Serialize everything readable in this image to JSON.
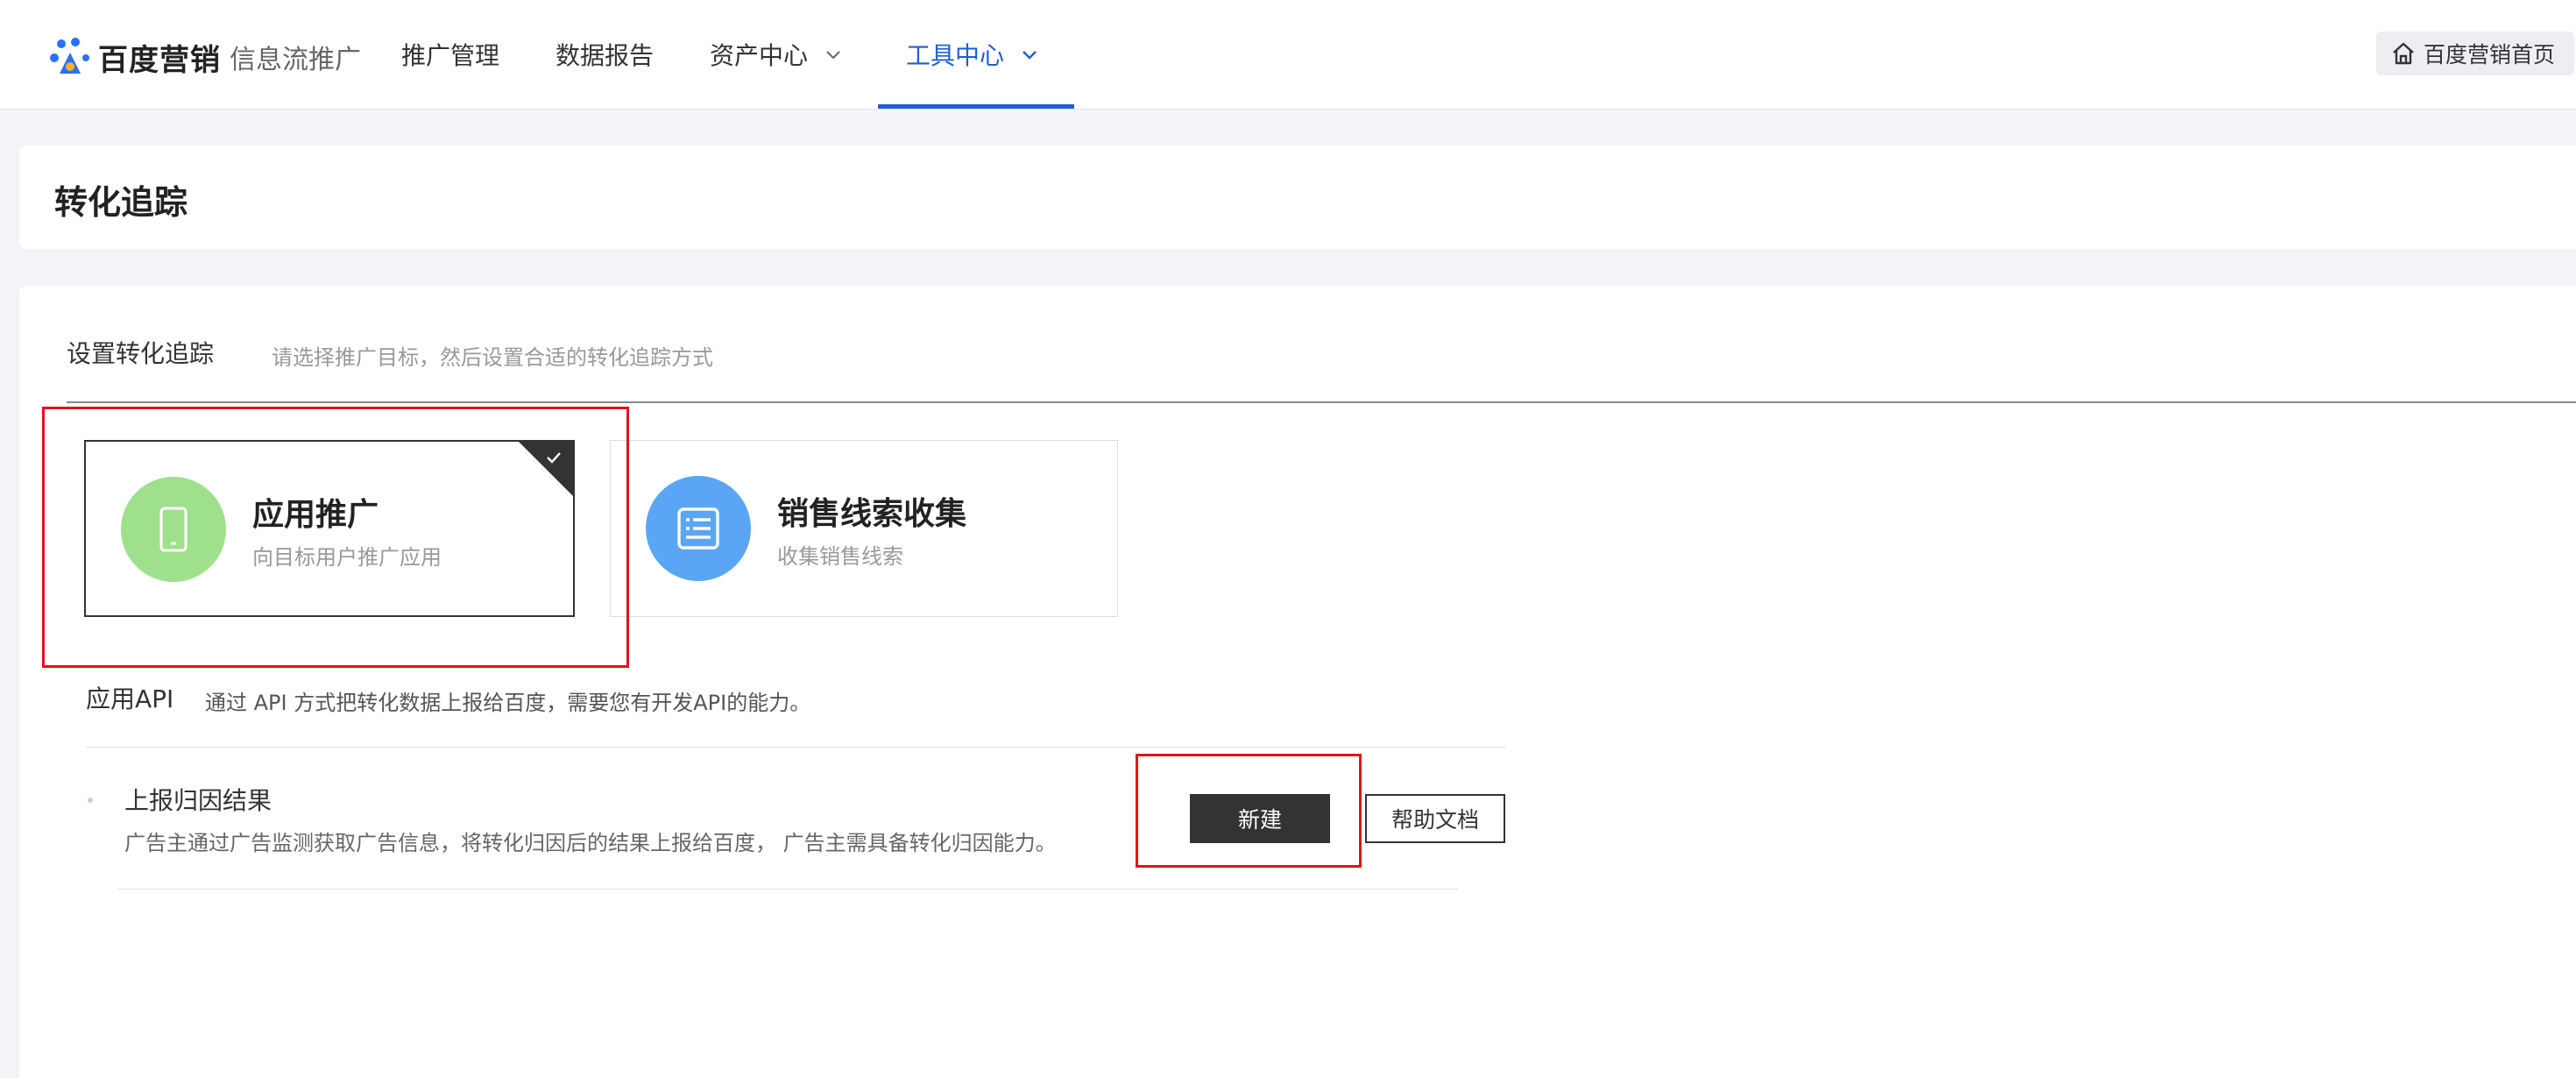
{
  "header": {
    "logo_icon": "baidu-paw-icon",
    "brand": "百度营销",
    "product": "信息流推广",
    "nav": [
      {
        "label": "推广管理"
      },
      {
        "label": "数据报告"
      },
      {
        "label": "资产中心"
      },
      {
        "label": "工具中心"
      }
    ],
    "active_nav": "工具中心",
    "home_button": "百度营销首页",
    "accent_color": "#1f5fcf"
  },
  "page": {
    "title": "转化追踪"
  },
  "setup": {
    "title": "设置转化追踪",
    "desc": "请选择推广目标，然后设置合适的转化追踪方式",
    "options": [
      {
        "title": "应用推广",
        "subtitle": "向目标用户推广应用",
        "icon": "mobile-phone-icon",
        "icon_color": "#9fe08c",
        "selected": true
      },
      {
        "title": "销售线索收集",
        "subtitle": "收集销售线索",
        "icon": "list-document-icon",
        "icon_color": "#5aa6f5",
        "selected": false
      }
    ]
  },
  "api": {
    "label": "应用API",
    "desc": "通过 API 方式把转化数据上报给百度，需要您有开发API的能力。",
    "item": {
      "title": "上报归因结果",
      "desc": "广告主通过广告监测获取广告信息，将转化归因后的结果上报给百度， 广告主需具备转化归因能力。",
      "new_button": "新建",
      "help_button": "帮助文档"
    }
  },
  "annotation_color": "#e0141c"
}
